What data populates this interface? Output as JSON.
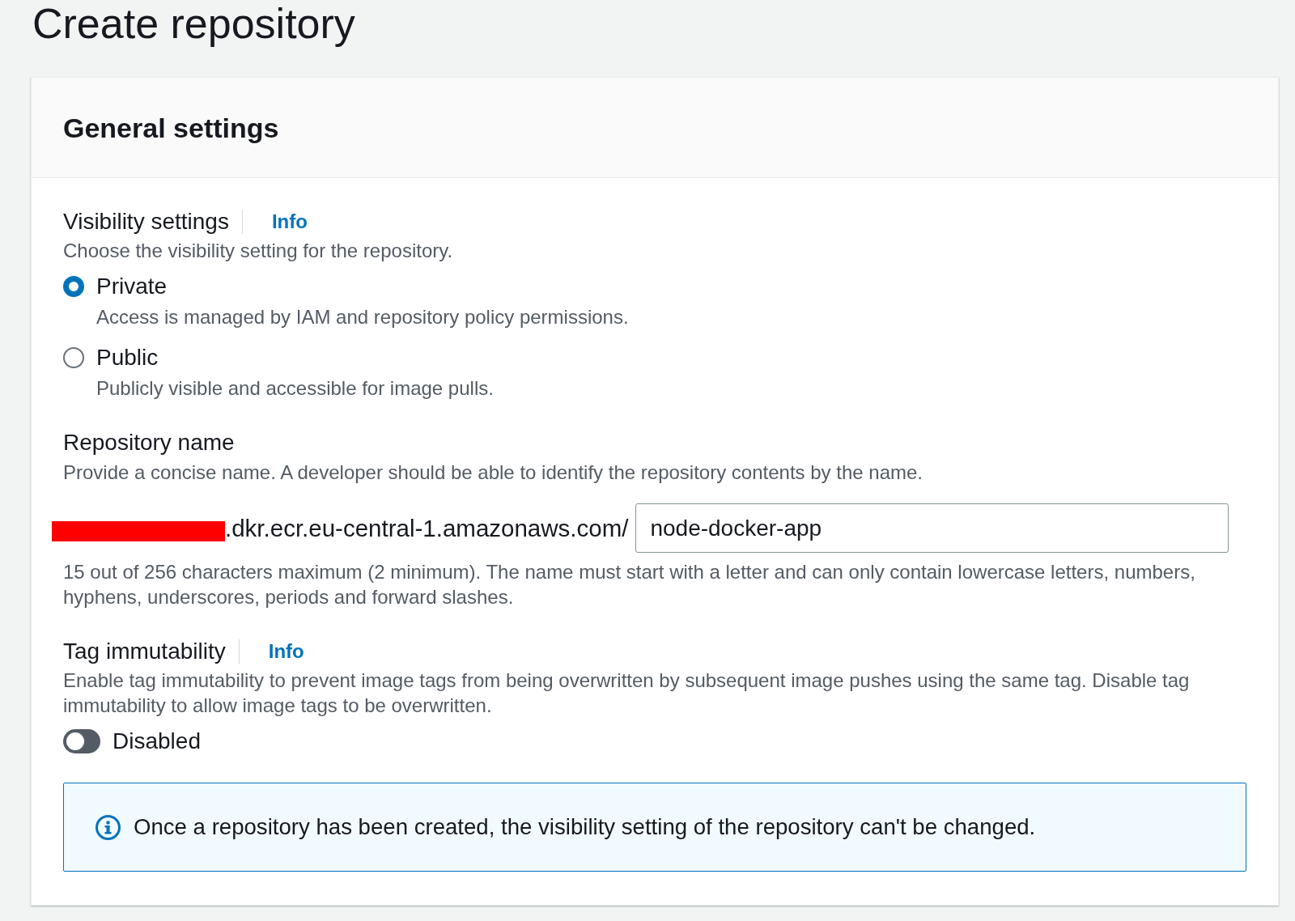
{
  "page": {
    "title": "Create repository"
  },
  "panel": {
    "title": "General settings",
    "visibility": {
      "label": "Visibility settings",
      "info_link": "Info",
      "description": "Choose the visibility setting for the repository.",
      "options": [
        {
          "label": "Private",
          "description": "Access is managed by IAM and repository policy permissions.",
          "selected": true
        },
        {
          "label": "Public",
          "description": "Publicly visible and accessible for image pulls.",
          "selected": false
        }
      ]
    },
    "repository_name": {
      "label": "Repository name",
      "description": "Provide a concise name. A developer should be able to identify the repository contents by the name.",
      "prefix_redacted": true,
      "prefix": ".dkr.ecr.eu-central-1.amazonaws.com/",
      "value": "node-docker-app",
      "constraint": "15 out of 256 characters maximum (2 minimum). The name must start with a letter and can only contain lowercase letters, numbers, hyphens, underscores, periods and forward slashes."
    },
    "tag_immutability": {
      "label": "Tag immutability",
      "info_link": "Info",
      "description": "Enable tag immutability to prevent image tags from being overwritten by subsequent image pushes using the same tag. Disable tag immutability to allow image tags to be overwritten.",
      "toggle": {
        "label": "Disabled",
        "on": false
      }
    },
    "alert": {
      "text": "Once a repository has been created, the visibility setting of the repository can't be changed."
    }
  }
}
